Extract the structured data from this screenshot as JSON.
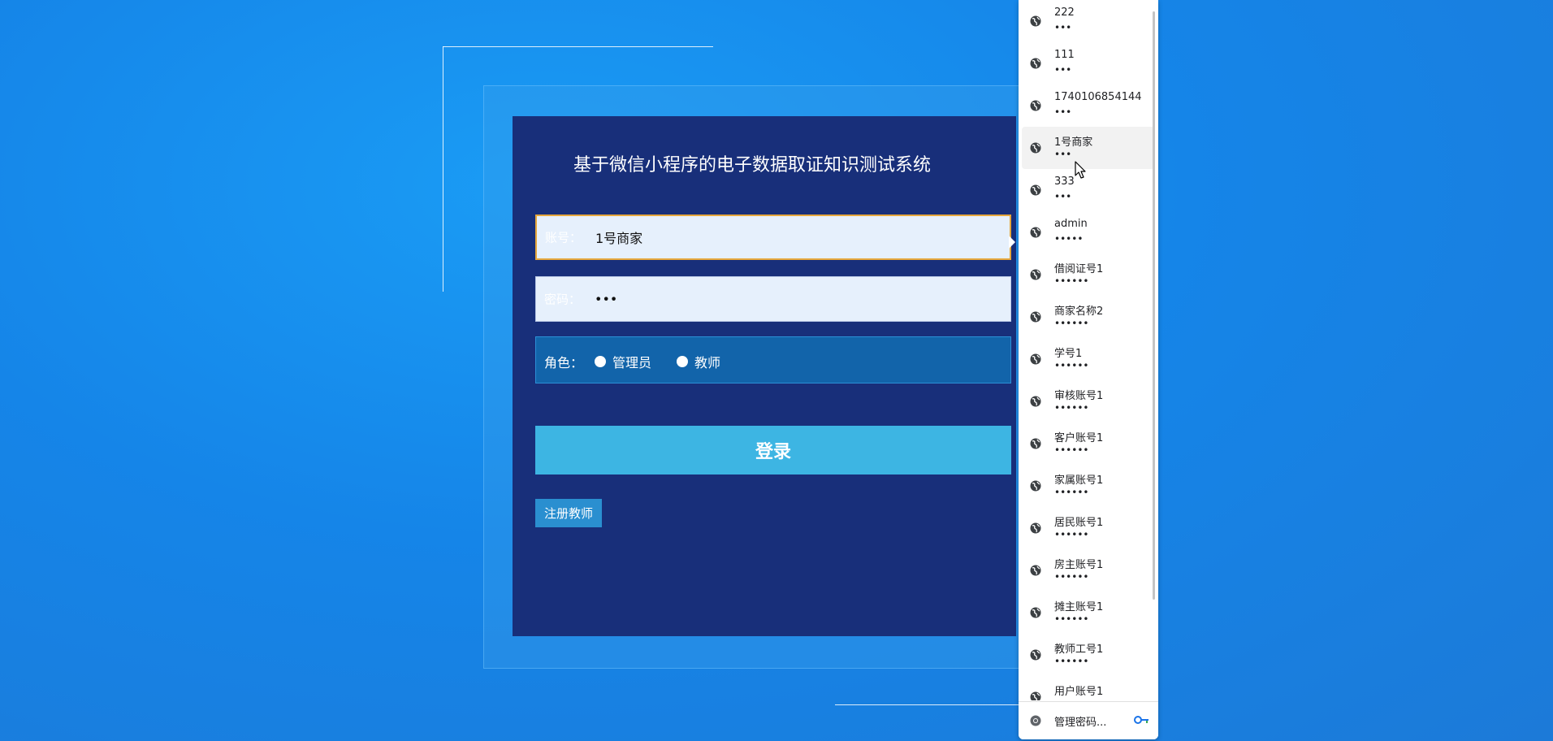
{
  "login": {
    "title": "基于微信小程序的电子数据取证知识测试系统",
    "username_label": "账号：",
    "username_value": "1号商家",
    "password_label": "密码：",
    "password_value": "•••",
    "role_label": "角色：",
    "roles": [
      "管理员",
      "教师"
    ],
    "login_button": "登录",
    "register_button": "注册教师"
  },
  "password_popup": {
    "items": [
      {
        "user": "222",
        "mask": "•••"
      },
      {
        "user": "111",
        "mask": "•••"
      },
      {
        "user": "1740106854144",
        "mask": "•••"
      },
      {
        "user": "1号商家",
        "mask": "•••"
      },
      {
        "user": "333",
        "mask": "•••"
      },
      {
        "user": "admin",
        "mask": "•••••"
      },
      {
        "user": "借阅证号1",
        "mask": "••••••"
      },
      {
        "user": "商家名称2",
        "mask": "••••••"
      },
      {
        "user": "学号1",
        "mask": "••••••"
      },
      {
        "user": "审核账号1",
        "mask": "••••••"
      },
      {
        "user": "客户账号1",
        "mask": "••••••"
      },
      {
        "user": "家属账号1",
        "mask": "••••••"
      },
      {
        "user": "居民账号1",
        "mask": "••••••"
      },
      {
        "user": "房主账号1",
        "mask": "••••••"
      },
      {
        "user": "摊主账号1",
        "mask": "••••••"
      },
      {
        "user": "教师工号1",
        "mask": "••••••"
      },
      {
        "user": "用户账号1",
        "mask": "••••••"
      }
    ],
    "manage_label": "管理密码..."
  }
}
